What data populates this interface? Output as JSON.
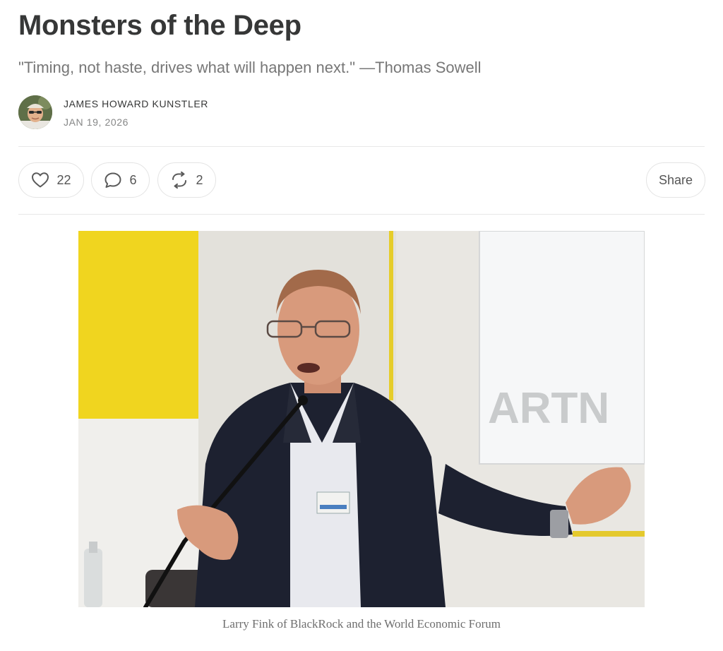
{
  "post": {
    "title": "Monsters of the Deep",
    "subtitle": "\"Timing, not haste, drives what will happen next.\" —Thomas Sowell",
    "author": "JAMES HOWARD KUNSTLER",
    "date": "JAN 19, 2026"
  },
  "actions": {
    "likes": "22",
    "comments": "6",
    "restacks": "2",
    "share_label": "Share"
  },
  "image": {
    "caption": "Larry Fink of BlackRock and the World Economic Forum",
    "sign_text": "ARTN"
  },
  "icons": [
    "heart-icon",
    "comment-icon",
    "restack-icon"
  ]
}
